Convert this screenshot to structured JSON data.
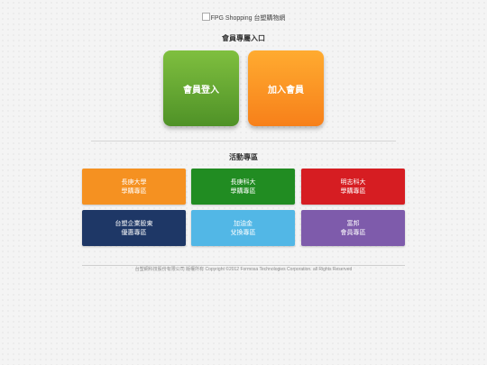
{
  "logo": {
    "alt_text": "FPG Shopping",
    "site_name": "台塑購物網"
  },
  "member": {
    "title": "會員專屬入口",
    "login_label": "會員登入",
    "join_label": "加入會員",
    "login_color": "#4f9227",
    "join_color": "#f7801a"
  },
  "events": {
    "title": "活動專區",
    "tiles": [
      {
        "line1": "長庚大學",
        "line2": "學購專區",
        "color": "#f59121"
      },
      {
        "line1": "長庚科大",
        "line2": "學購專區",
        "color": "#218c22"
      },
      {
        "line1": "明志科大",
        "line2": "學購專區",
        "color": "#d61d22"
      },
      {
        "line1": "台塑企業股東",
        "line2": "優惠專區",
        "color": "#1e3766"
      },
      {
        "line1": "加油金",
        "line2": "兌換專區",
        "color": "#52b7e6"
      },
      {
        "line1": "富邦",
        "line2": "會員專區",
        "color": "#7e5bab"
      }
    ]
  },
  "footer": {
    "text": "台塑網科技股份有限公司 版權所有 Copyright ©2012 Formosa Technologies Corporation. all Rights Reserved"
  }
}
